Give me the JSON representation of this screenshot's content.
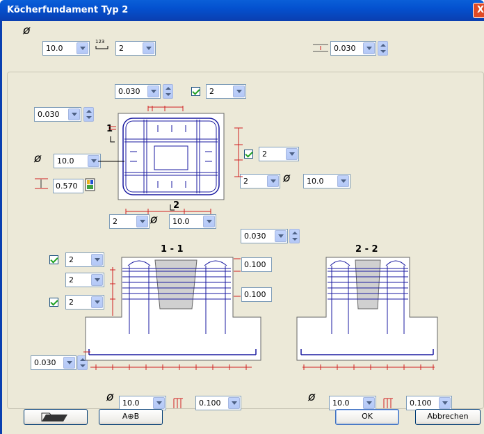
{
  "window": {
    "title": "Köcherfundament Typ 2",
    "close": "X"
  },
  "top": {
    "diameter": "10.0",
    "count": "2",
    "cover": "0.030"
  },
  "plan": {
    "cover_top": "0.030",
    "count_top": "2",
    "cover_left": "0.030",
    "diameter_left": "10.0",
    "height_value": "0.570",
    "count_right1": "2",
    "count_right2": "2",
    "diameter_right": "10.0",
    "count_bottom": "2",
    "diameter_bottom": "10.0",
    "marker_1": "1",
    "marker_2": "2"
  },
  "section11": {
    "title": "1 - 1",
    "cover": "0.030",
    "spacing1": "0.100",
    "spacing2": "0.100",
    "count1": "2",
    "count2": "2",
    "count3": "2",
    "cover_bottom": "0.030",
    "diameter": "10.0",
    "spacing_bottom": "0.100"
  },
  "section22": {
    "title": "2 - 2",
    "diameter": "10.0",
    "spacing_bottom": "0.100"
  },
  "buttons": {
    "ab": "A⊕B",
    "ok": "OK",
    "cancel": "Abbrechen"
  },
  "colors": {
    "rebar": "#1a1aa0",
    "dim": "#d02020"
  }
}
